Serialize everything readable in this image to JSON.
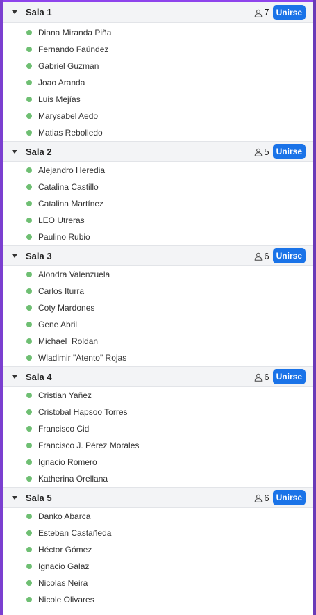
{
  "colors": {
    "accent": "#1a73e8",
    "online_dot": "#6fbf73",
    "header_bg": "#f3f4f6"
  },
  "icons": {
    "caret": "caret-down-icon",
    "person": "person-icon",
    "status": "online-dot-icon"
  },
  "rooms": [
    {
      "name": "Sala 1",
      "count": "7",
      "join_label": "Unirse",
      "members": [
        "Diana Miranda Piña",
        "Fernando Faúndez",
        "Gabriel Guzman",
        "Joao Aranda",
        "Luis Mejías",
        "Marysabel Aedo",
        "Matias Rebolledo"
      ]
    },
    {
      "name": "Sala 2",
      "count": "5",
      "join_label": "Unirse",
      "members": [
        "Alejandro Heredia",
        "Catalina Castillo",
        "Catalina Martínez",
        "LEO Utreras",
        "Paulino Rubio"
      ]
    },
    {
      "name": "Sala 3",
      "count": "6",
      "join_label": "Unirse",
      "members": [
        "Alondra Valenzuela",
        "Carlos Iturra",
        "Coty Mardones",
        "Gene Abril",
        "Michael  Roldan",
        "Wladimir \"Atento\" Rojas"
      ]
    },
    {
      "name": "Sala 4",
      "count": "6",
      "join_label": "Unirse",
      "members": [
        "Cristian Yañez",
        "Cristobal Hapsoo Torres",
        "Francisco Cid",
        "Francisco J. Pérez Morales",
        "Ignacio Romero",
        "Katherina Orellana"
      ]
    },
    {
      "name": "Sala 5",
      "count": "6",
      "join_label": "Unirse",
      "members": [
        "Danko Abarca",
        "Esteban Castañeda",
        "Héctor Gómez",
        "Ignacio Galaz",
        "Nicolas Neira",
        "Nicole Olivares"
      ]
    }
  ]
}
